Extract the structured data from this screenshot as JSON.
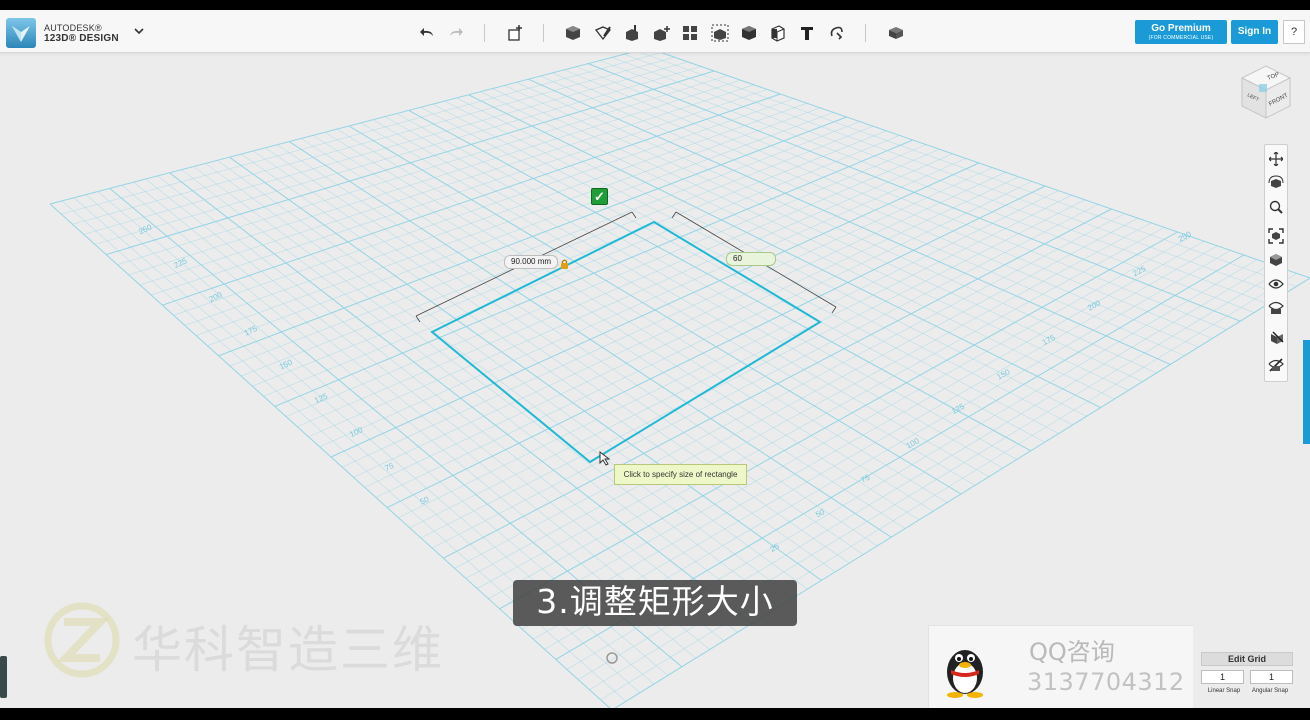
{
  "app": {
    "brand_line1": "AUTODESK®",
    "brand_line2": "123D® DESIGN",
    "menu_icon": "chevron-down-icon"
  },
  "toolbar": {
    "buttons": [
      {
        "name": "undo-icon"
      },
      {
        "name": "redo-icon"
      },
      {
        "name": "transform-icon"
      },
      {
        "name": "primitives-icon"
      },
      {
        "name": "sketch-icon"
      },
      {
        "name": "construct-icon"
      },
      {
        "name": "modify-icon"
      },
      {
        "name": "pattern-icon"
      },
      {
        "name": "group-icon"
      },
      {
        "name": "combine-icon"
      },
      {
        "name": "measure-icon"
      },
      {
        "name": "text-icon"
      },
      {
        "name": "snap-icon"
      },
      {
        "name": "materials-icon"
      }
    ],
    "premium_label": "Go Premium",
    "premium_sub": "(FOR COMMERCIAL USE)",
    "signin_label": "Sign In",
    "help_label": "?"
  },
  "viewcube": {
    "top": "TOP",
    "front": "FRONT",
    "left": "LEFT"
  },
  "navbar": {
    "buttons": [
      "pan-icon",
      "orbit-icon",
      "zoom-icon",
      "fit-icon",
      "views-icon",
      "visibility-icon",
      "material-view-icon",
      "snap-view-icon",
      "hide-icon"
    ]
  },
  "sketch": {
    "width_value": "90.000 mm",
    "height_value": "60",
    "tooltip": "Click to specify size of rectangle"
  },
  "grid_labels": {
    "left": [
      "250",
      "225",
      "200",
      "175",
      "150",
      "125",
      "100",
      "75",
      "50"
    ],
    "right": [
      "25",
      "50",
      "75",
      "100",
      "125",
      "150",
      "175",
      "200",
      "225",
      "250"
    ]
  },
  "subtitle": "3.调整矩形大小",
  "watermark": {
    "text": "华科智造三维"
  },
  "qq": {
    "title": "QQ咨询",
    "number": "3137704312"
  },
  "edit_grid": {
    "title": "Edit Grid",
    "linear_value": "1",
    "angular_value": "1",
    "linear_label": "Linear Snap",
    "angular_label": "Angular Snap"
  },
  "colors": {
    "accent": "#1a9bd7",
    "grid": "#8fd3e6",
    "sketch": "#1fb9d6"
  }
}
